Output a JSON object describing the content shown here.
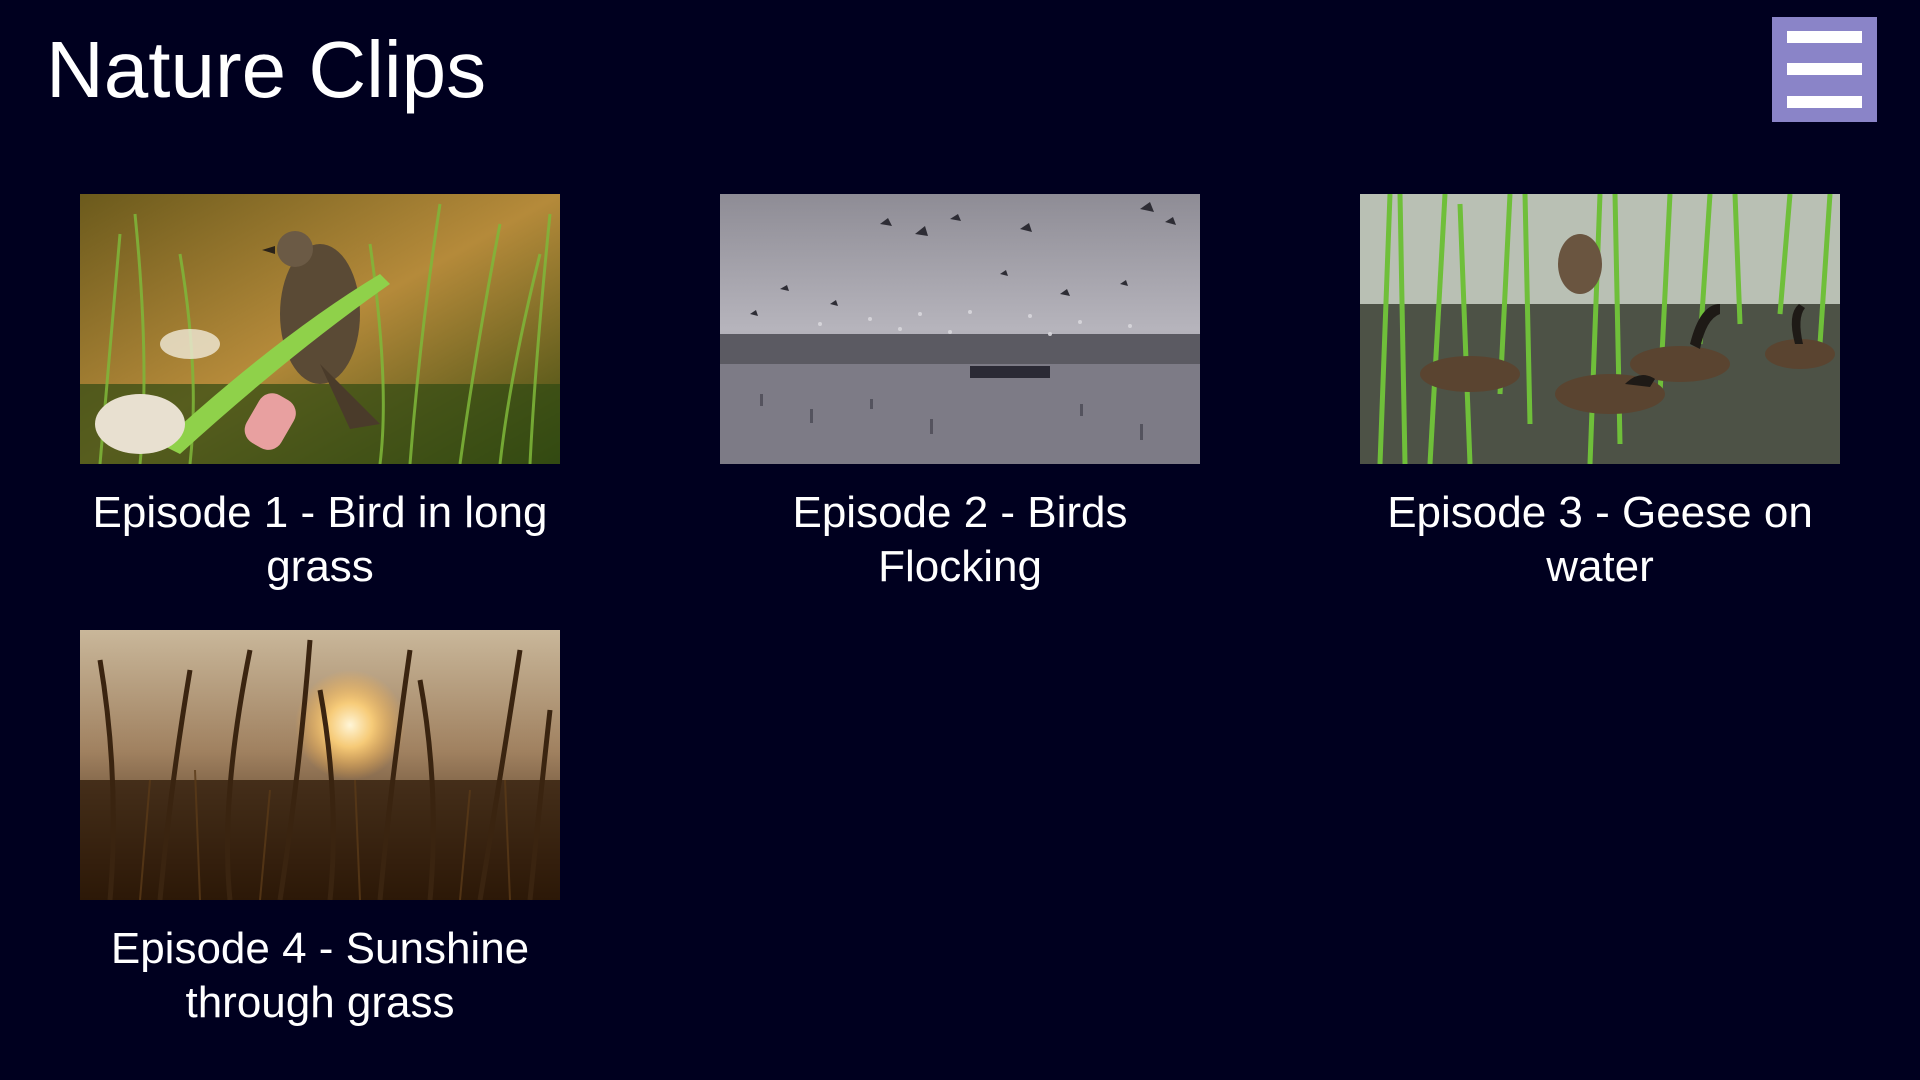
{
  "header": {
    "title": "Nature Clips",
    "menu_icon": "hamburger-menu-icon",
    "menu_color": "#8a84c8"
  },
  "background_color": "#00001f",
  "clips": [
    {
      "title": "Episode 1 - Bird in long grass",
      "thumbnail": "bird-in-grass-thumbnail"
    },
    {
      "title": "Episode 2 - Birds Flocking",
      "thumbnail": "birds-flocking-thumbnail"
    },
    {
      "title": "Episode 3 - Geese on water",
      "thumbnail": "geese-on-water-thumbnail"
    },
    {
      "title": "Episode 4 - Sunshine through grass",
      "thumbnail": "sunshine-through-grass-thumbnail"
    }
  ]
}
